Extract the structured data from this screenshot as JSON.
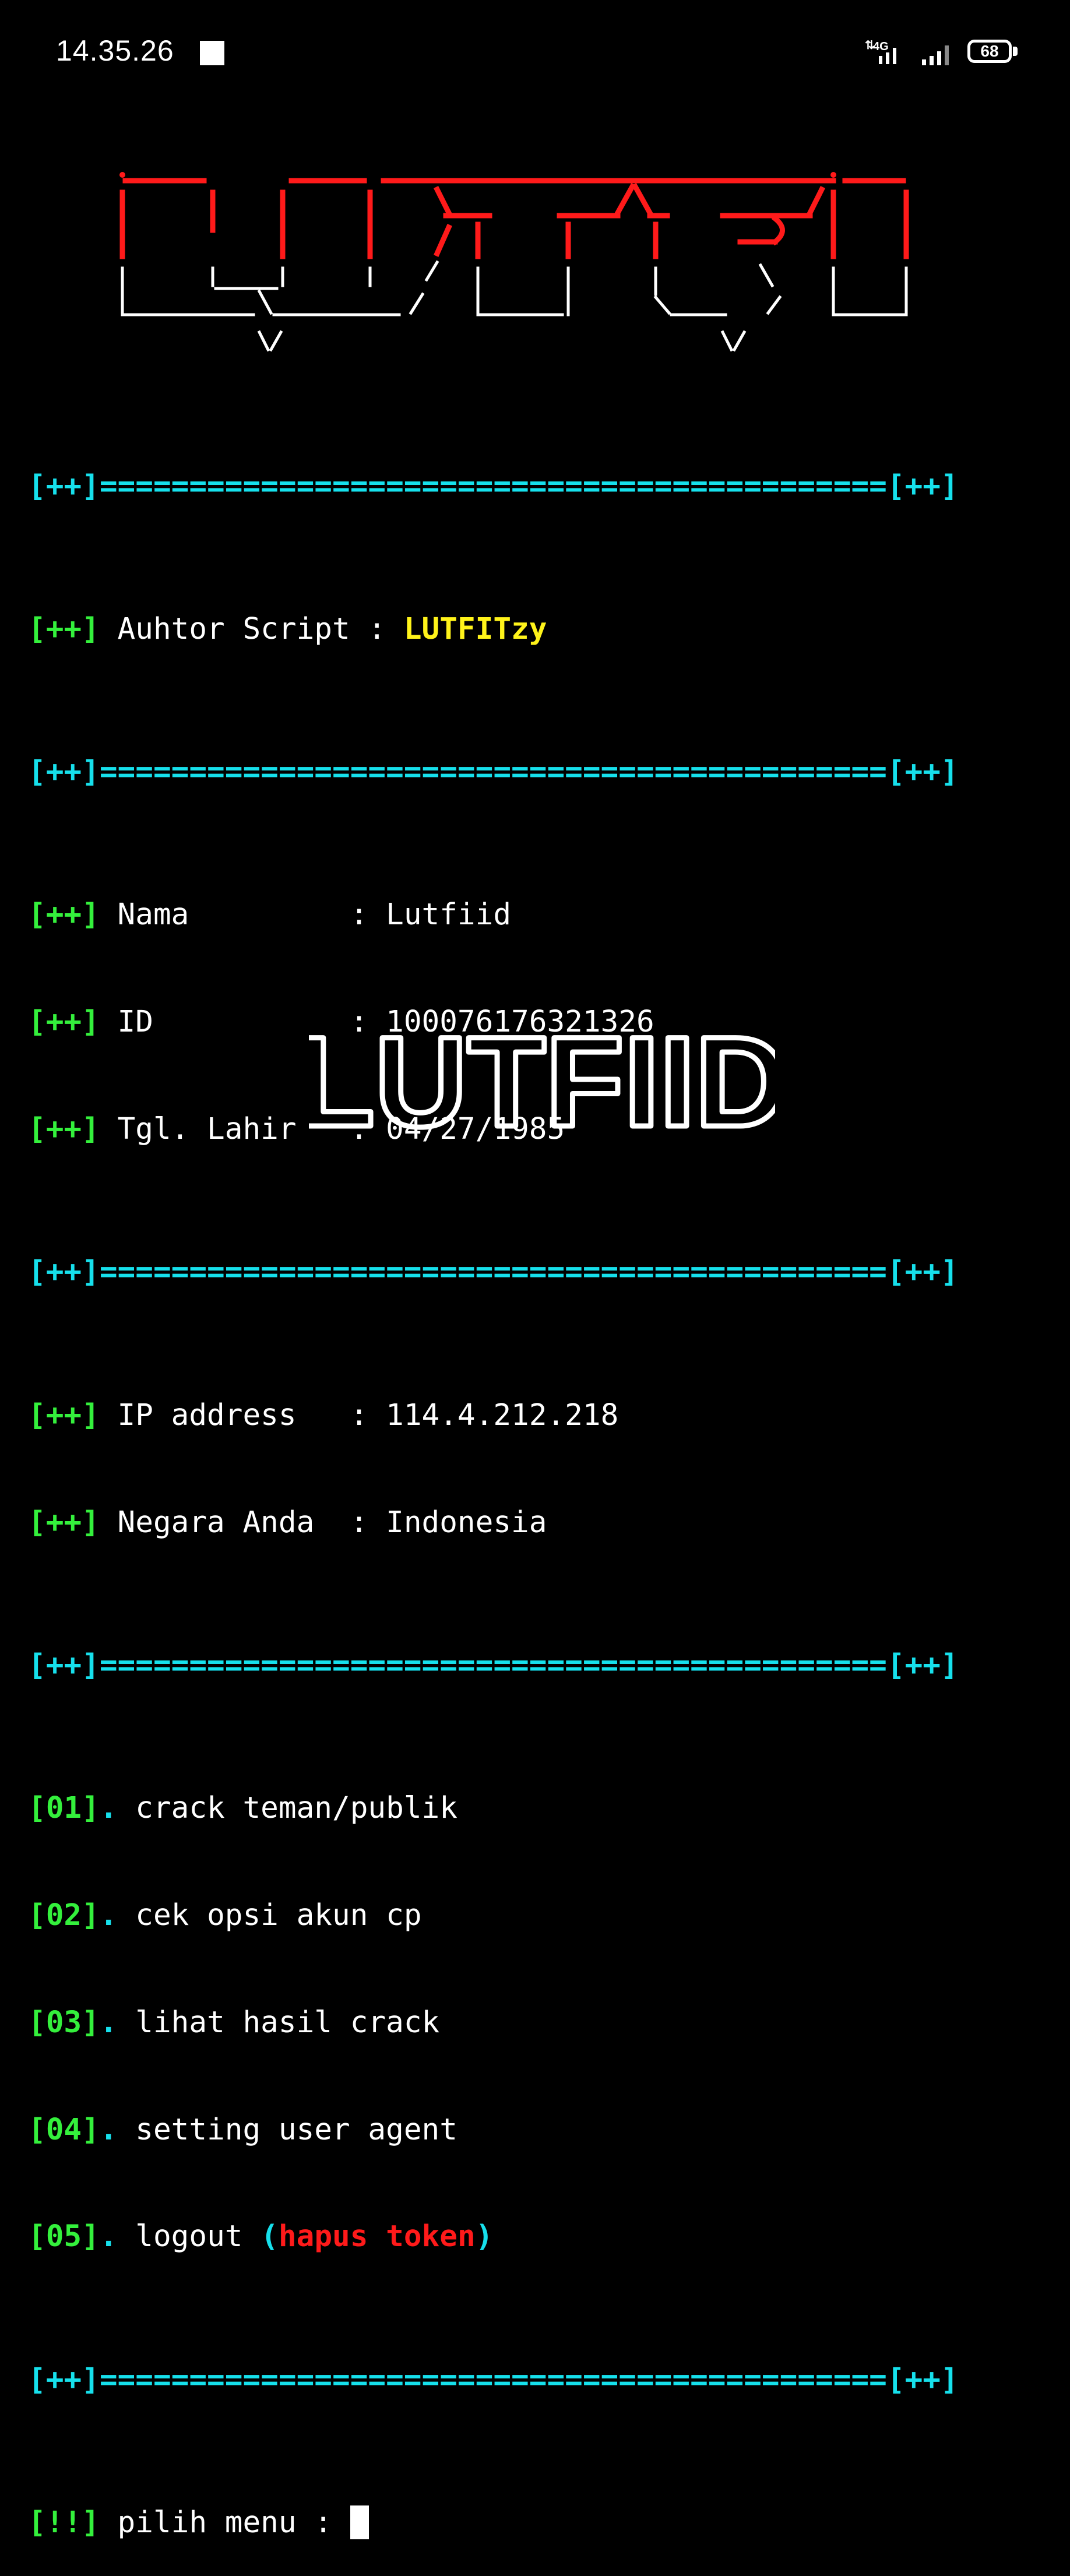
{
  "status_bar": {
    "time": "14.35.26",
    "network": "4G",
    "battery": "68"
  },
  "banner": {
    "text": "LUTFIID"
  },
  "separator": {
    "tag": "[++]",
    "fill": "============================================"
  },
  "author": {
    "tag": "[++]",
    "label": " Auhtor Script : ",
    "value": "LUTFITzy"
  },
  "profile": [
    {
      "tag": "[++]",
      "label": " Nama         : ",
      "value": "Lutfiid"
    },
    {
      "tag": "[++]",
      "label": " ID           : ",
      "value": "100076176321326"
    },
    {
      "tag": "[++]",
      "label": " Tgl. Lahir   : ",
      "value": "04/27/1985"
    }
  ],
  "network_info": [
    {
      "tag": "[++]",
      "label": " IP address   : ",
      "value": "114.4.212.218"
    },
    {
      "tag": "[++]",
      "label": " Negara Anda  : ",
      "value": "Indonesia"
    }
  ],
  "menu": [
    {
      "num": "[01]",
      "label": "crack teman/publik"
    },
    {
      "num": "[02]",
      "label": "cek opsi akun cp"
    },
    {
      "num": "[03]",
      "label": "lihat hasil crack"
    },
    {
      "num": "[04]",
      "label": "setting user agent"
    },
    {
      "num": "[05]",
      "label": "logout ",
      "paren_open": "(",
      "extra": "hapus token",
      "paren_close": ")"
    }
  ],
  "prompt": {
    "tag": "[!!]",
    "label": " pilih menu : "
  },
  "watermark": "LUTFIID",
  "colors": {
    "background": "#000000",
    "cyan": "#16e0ec",
    "green": "#34f03c",
    "yellow": "#fff31a",
    "red": "#ff1a1a",
    "white": "#ffffff"
  }
}
